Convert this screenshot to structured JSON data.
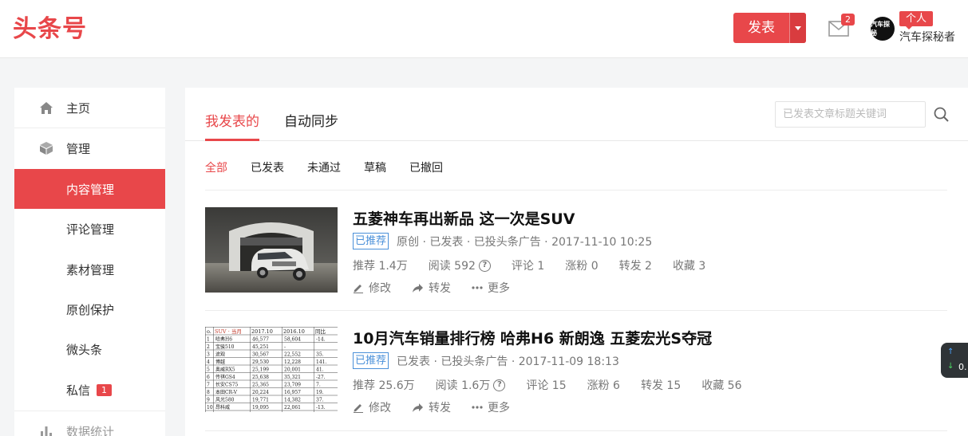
{
  "header": {
    "logo": "头条号",
    "publish_label": "发表",
    "mail_count": "2",
    "role_badge": "个人",
    "username": "汽车探秘者",
    "avatar_text": "汽车探秘"
  },
  "sidebar": {
    "items": [
      {
        "label": "主页"
      },
      {
        "label": "管理"
      },
      {
        "label": "内容管理"
      },
      {
        "label": "评论管理"
      },
      {
        "label": "素材管理"
      },
      {
        "label": "原创保护"
      },
      {
        "label": "微头条"
      },
      {
        "label": "私信",
        "badge": "1"
      },
      {
        "label": "数据统计"
      }
    ]
  },
  "main": {
    "tabs": [
      {
        "label": "我发表的"
      },
      {
        "label": "自动同步"
      }
    ],
    "search_placeholder": "已发表文章标题关键词",
    "subtabs": [
      {
        "label": "全部"
      },
      {
        "label": "已发表"
      },
      {
        "label": "未通过"
      },
      {
        "label": "草稿"
      },
      {
        "label": "已撤回"
      }
    ],
    "articles": [
      {
        "title": "五菱神车再出新品 这一次是SUV",
        "badge": "已推荐",
        "meta": "原创 · 已发表 · 已投头条广告 · 2017-11-10 10:25",
        "rec": "推荐 1.4万",
        "read": "阅读 592",
        "comment": "评论 1",
        "fans": "涨粉 0",
        "repost": "转发 2",
        "fav": "收藏 3",
        "edit": "修改",
        "share": "转发",
        "more": "更多"
      },
      {
        "title": "10月汽车销量排行榜 哈弗H6 新朗逸 五菱宏光S夺冠",
        "badge": "已推荐",
        "meta": "已发表 · 已投头条广告 · 2017-11-09 18:13",
        "rec": "推荐 25.6万",
        "read": "阅读 1.6万",
        "comment": "评论 15",
        "fans": "涨粉 6",
        "repost": "转发 15",
        "fav": "收藏 56",
        "edit": "修改",
        "share": "转发",
        "more": "更多"
      }
    ]
  },
  "thumb2_table": {
    "header": [
      "SUV · 当月",
      "2017.10",
      "2016.10",
      "同比"
    ],
    "rows": [
      [
        "哈弗H6",
        "46,577",
        "58,604",
        "-14."
      ],
      [
        "宝骏510",
        "45,251",
        "-",
        ""
      ],
      [
        "途观",
        "30,567",
        "22,552",
        "35."
      ],
      [
        "博越",
        "29,530",
        "12,228",
        "141."
      ],
      [
        "奥威RX5",
        "25,199",
        "20,001",
        "41."
      ],
      [
        "传祺GS4",
        "25,638",
        "35,321",
        "-27."
      ],
      [
        "长安CS75",
        "25,365",
        "23,709",
        "7."
      ],
      [
        "本田CR-V",
        "20,224",
        "16,957",
        "19."
      ],
      [
        "风光580",
        "19,771",
        "14,382",
        "37."
      ],
      [
        "昂科威",
        "19,095",
        "22,061",
        "-13."
      ]
    ]
  },
  "float_widget": {
    "value": "0."
  },
  "colors": {
    "brand": "#e8474a",
    "recommended": "#4a90d9"
  }
}
